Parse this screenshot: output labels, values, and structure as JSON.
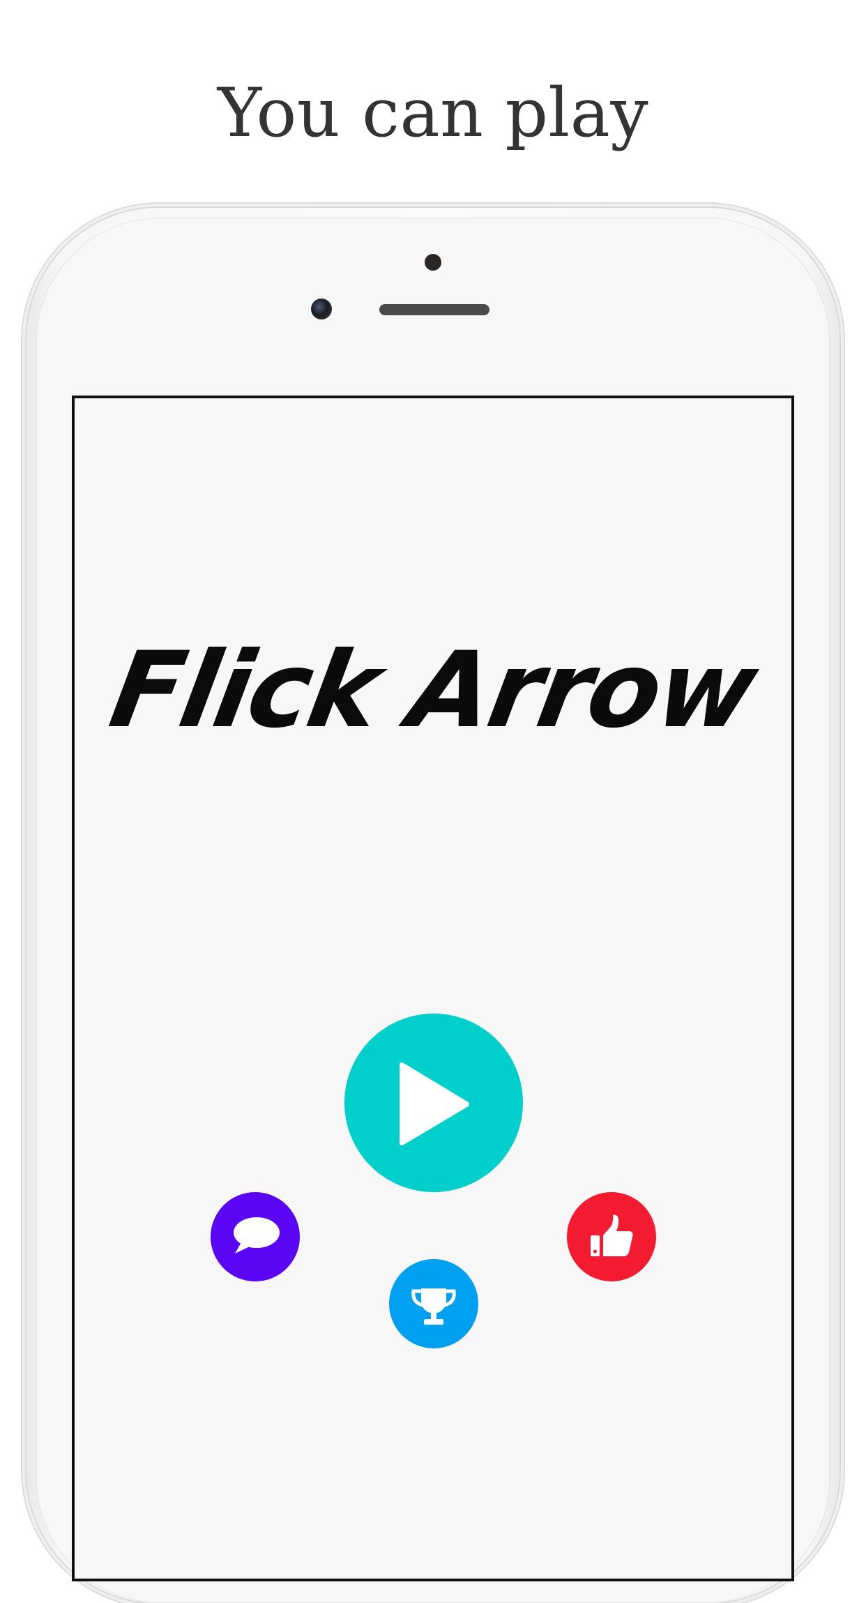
{
  "headline": "You can play",
  "game": {
    "title": "Flick Arrow"
  },
  "buttons": {
    "play": {
      "icon": "play-icon",
      "color": "#00CFCC"
    },
    "chat": {
      "icon": "speech-bubble-icon",
      "color": "#5B05F5"
    },
    "leaderboard": {
      "icon": "trophy-icon",
      "color": "#00A0F0"
    },
    "like": {
      "icon": "thumbs-up-icon",
      "color": "#F41A2F"
    }
  },
  "colors": {
    "background": "#FFFFFF",
    "screen": "#F7F7F7",
    "headline_text": "#333333",
    "title_text": "#0B0B0B"
  }
}
